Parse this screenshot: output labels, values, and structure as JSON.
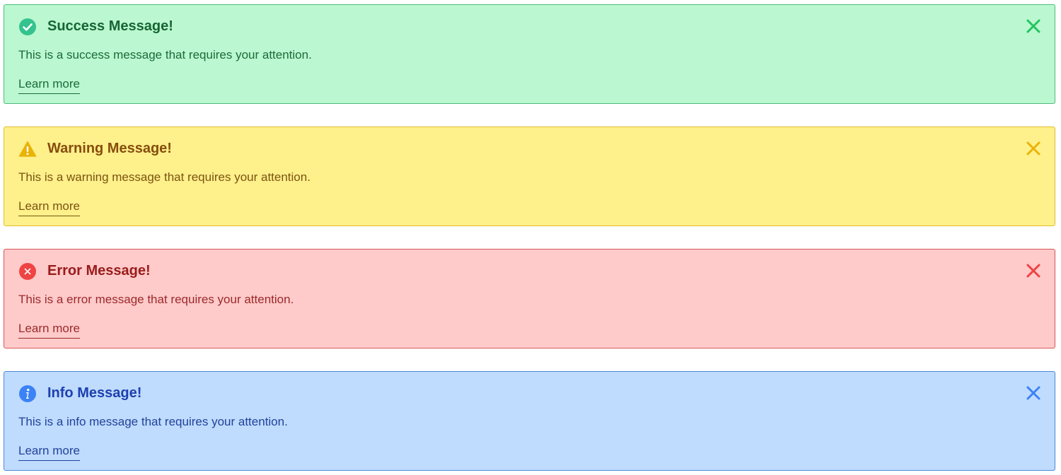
{
  "alerts": [
    {
      "type": "success",
      "icon": "check-circle-icon",
      "title": "Success Message!",
      "message": "This is a success message that requires your attention.",
      "link": "Learn more",
      "icon_color": "#34c38f",
      "close_color": "#22c55e"
    },
    {
      "type": "warning",
      "icon": "warning-triangle-icon",
      "title": "Warning Message!",
      "message": "This is a warning message that requires your attention.",
      "link": "Learn more",
      "icon_color": "#eab308",
      "close_color": "#eab308"
    },
    {
      "type": "error",
      "icon": "x-circle-icon",
      "title": "Error Message!",
      "message": "This is a error message that requires your attention.",
      "link": "Learn more",
      "icon_color": "#ef4444",
      "close_color": "#ef4444"
    },
    {
      "type": "info",
      "icon": "info-circle-icon",
      "title": "Info Message!",
      "message": "This is a info message that requires your attention.",
      "link": "Learn more",
      "icon_color": "#3b82f6",
      "close_color": "#3b82f6"
    }
  ]
}
